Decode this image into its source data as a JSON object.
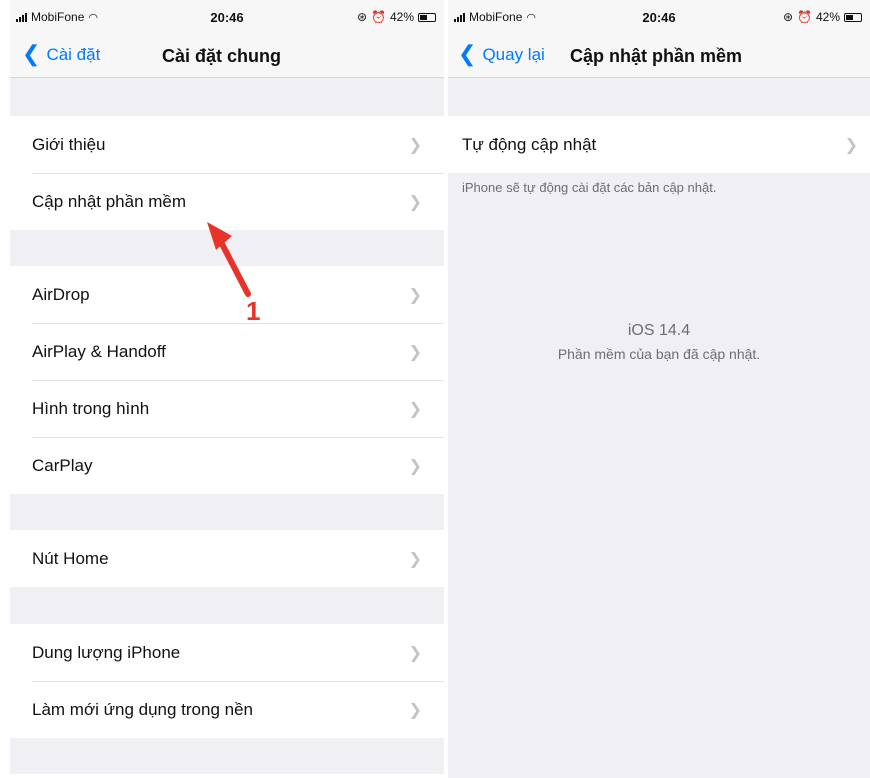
{
  "left_screen": {
    "status": {
      "carrier": "MobiFone",
      "time": "20:46",
      "battery": "42%"
    },
    "nav": {
      "back_label": "Cài đặt",
      "title": "Cài đặt chung"
    },
    "groups": [
      [
        "Giới thiệu",
        "Cập nhật phần mềm"
      ],
      [
        "AirDrop",
        "AirPlay & Handoff",
        "Hình trong hình",
        "CarPlay"
      ],
      [
        "Nút Home"
      ],
      [
        "Dung lượng iPhone",
        "Làm mới ứng dụng trong nền"
      ]
    ]
  },
  "right_screen": {
    "status": {
      "carrier": "MobiFone",
      "time": "20:46",
      "battery": "42%"
    },
    "nav": {
      "back_label": "Quay lại",
      "title": "Cập nhật phần mềm"
    },
    "auto_update_label": "Tự động cập nhật",
    "auto_update_note": "iPhone sẽ tự động cài đặt các bản cập nhật.",
    "ios_version": "iOS 14.4",
    "status_message": "Phần mềm của bạn đã cập nhật."
  },
  "annotation": {
    "label": "1",
    "color": "#e7332a"
  },
  "colors": {
    "accent": "#007aff",
    "background": "#efeff4"
  }
}
